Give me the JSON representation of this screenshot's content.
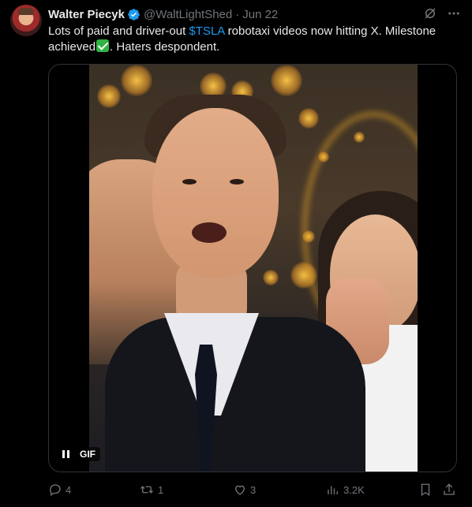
{
  "author": {
    "name": "Walter Piecyk",
    "handle": "@WaltLightShed",
    "separator": "·",
    "date": "Jun 22"
  },
  "tweet": {
    "text_before": "Lots of paid and driver-out ",
    "cashtag": "$TSLA",
    "text_after": " robotaxi videos now hitting X.  Milestone achieved",
    "text_end": ". Haters despondent."
  },
  "media": {
    "type_badge": "GIF",
    "state": "playing"
  },
  "actions": {
    "replies": "4",
    "reposts": "1",
    "likes": "3",
    "views": "3.2K"
  },
  "colors": {
    "background": "#000000",
    "text": "#e7e9ea",
    "muted": "#71767b",
    "accent": "#1d9bf0",
    "border": "#2f3336",
    "check": "#2fb344"
  },
  "icons": [
    "verified-badge-icon",
    "grok-icon",
    "more-icon",
    "pause-icon",
    "reply-icon",
    "repost-icon",
    "like-icon",
    "views-icon",
    "bookmark-icon",
    "share-icon"
  ]
}
